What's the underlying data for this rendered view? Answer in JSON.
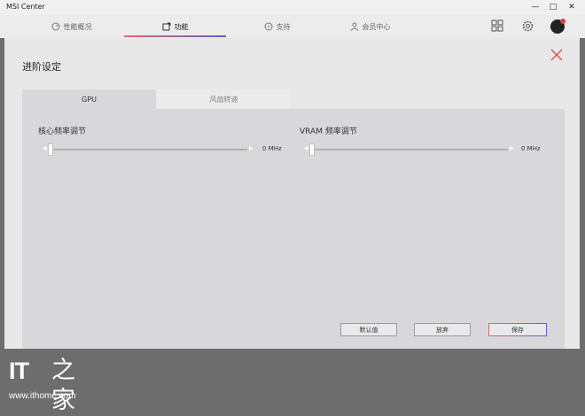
{
  "window": {
    "title": "MSI Center",
    "controls": {
      "minimize": "—",
      "maximize": "□",
      "close": "✕"
    }
  },
  "topnav": {
    "items": [
      {
        "label": "性能概况",
        "icon": "gauge-icon"
      },
      {
        "label": "功能",
        "icon": "feature-icon",
        "active": true
      },
      {
        "label": "支持",
        "icon": "support-icon"
      },
      {
        "label": "会员中心",
        "icon": "user-icon"
      }
    ],
    "tools": [
      "grid-icon",
      "gear-icon",
      "avatar"
    ]
  },
  "modal": {
    "title": "进阶设定",
    "tabs": [
      {
        "label": "GPU",
        "active": true
      },
      {
        "label": "风扇转速",
        "active": false
      }
    ],
    "sliders": [
      {
        "label": "核心频率调节",
        "value": "0 MHz"
      },
      {
        "label": "VRAM 频率调节",
        "value": "0 MHz"
      }
    ],
    "buttons": {
      "default": "默认值",
      "discard": "放弃",
      "save": "保存"
    }
  },
  "watermark": {
    "logo": "IT",
    "glyph": "之家",
    "url": "www.ithome.com"
  },
  "colors": {
    "accent_red": "#e04a4a",
    "accent_purple": "#6a5acd",
    "panel": "#d8d8db"
  }
}
